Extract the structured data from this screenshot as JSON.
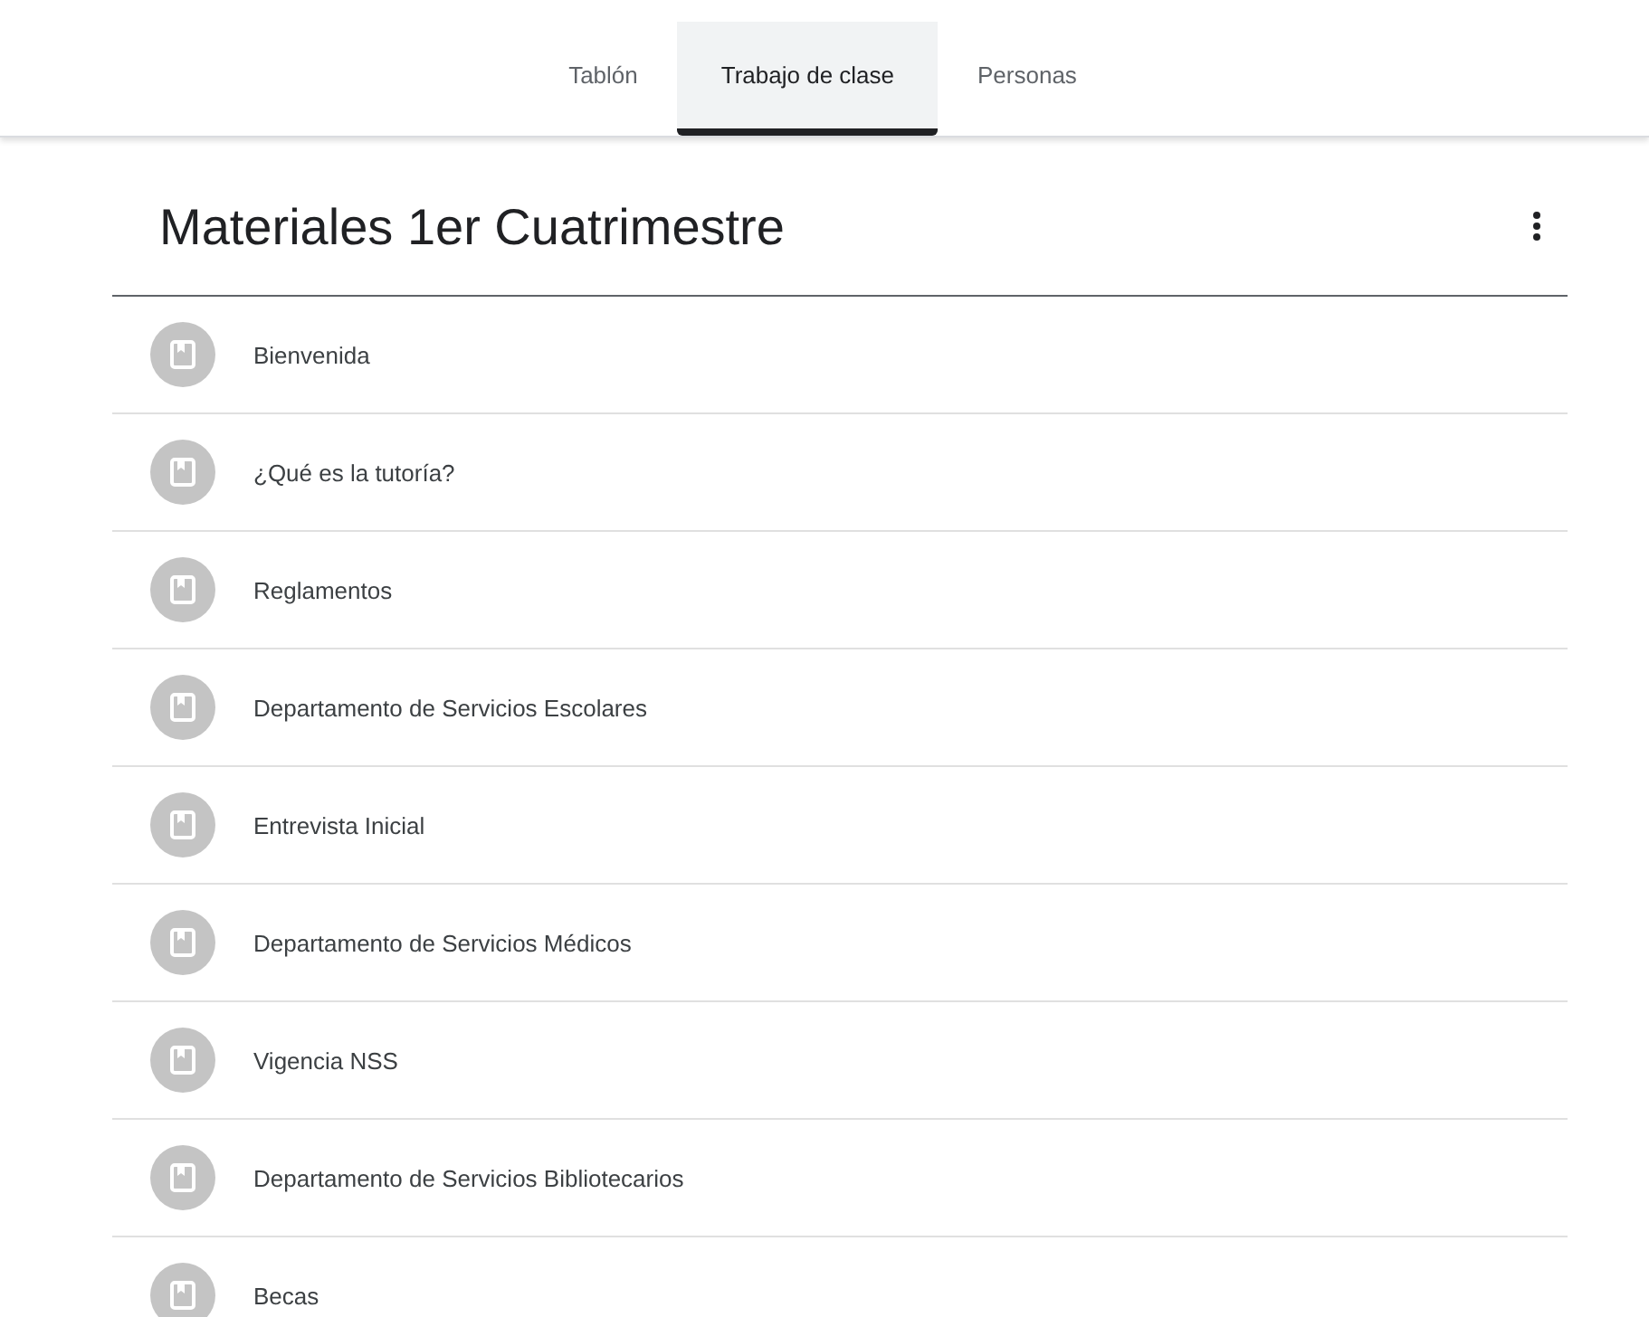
{
  "tabs": [
    {
      "label": "Tablón",
      "selected": false
    },
    {
      "label": "Trabajo de clase",
      "selected": true
    },
    {
      "label": "Personas",
      "selected": false
    }
  ],
  "topic": {
    "title": "Materiales 1er Cuatrimestre",
    "items": [
      {
        "title": "Bienvenida"
      },
      {
        "title": "¿Qué es la tutoría?"
      },
      {
        "title": "Reglamentos"
      },
      {
        "title": "Departamento de Servicios Escolares"
      },
      {
        "title": "Entrevista Inicial"
      },
      {
        "title": "Departamento de Servicios Médicos"
      },
      {
        "title": "Vigencia NSS"
      },
      {
        "title": "Departamento de Servicios Bibliotecarios"
      },
      {
        "title": "Becas"
      }
    ]
  }
}
